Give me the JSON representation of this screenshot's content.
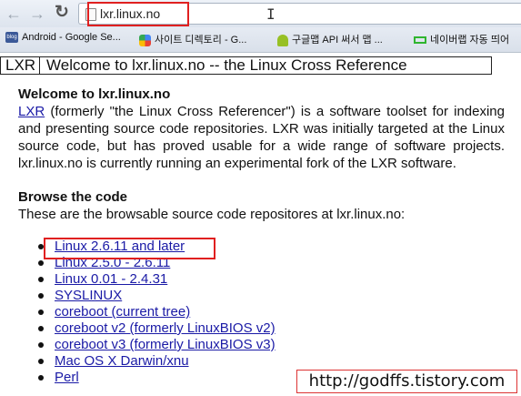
{
  "browser": {
    "back_icon": "back-arrow-icon",
    "forward_icon": "forward-arrow-icon",
    "reload_icon": "reload-icon",
    "url": "lxr.linux.no"
  },
  "bookmarks": [
    {
      "label": "Android - Google Se...",
      "icon": "blog-icon"
    },
    {
      "label": "사이트 디렉토리 - G...",
      "icon": "puzzle-icon"
    },
    {
      "label": "구글맵 API 써서 맵 ...",
      "icon": "android-icon"
    },
    {
      "label": "네이버랩 자동 띄어",
      "icon": "naver-icon"
    }
  ],
  "lxr_header": {
    "logo": "LXR",
    "title": "Welcome to lxr.linux.no -- the Linux Cross Reference"
  },
  "content": {
    "heading": "Welcome to lxr.linux.no",
    "intro_link": "LXR",
    "intro_text": " (formerly \"the Linux Cross Referencer\") is a software toolset for indexing and presenting source code repositories. LXR was initially targeted at the Linux source code, but has proved usable for a wide range of software projects. lxr.linux.no is currently running an experimental fork of the LXR software.",
    "browse_heading": "Browse the code",
    "browse_desc": "These are the browsable source code repositores at lxr.linux.no:",
    "repos": [
      "Linux 2.6.11 and later",
      "Linux 2.5.0 - 2.6.11",
      "Linux 0.01 - 2.4.31",
      "SYSLINUX",
      "coreboot (current tree)",
      "coreboot v2 (formerly LinuxBIOS v2)",
      "coreboot v3 (formerly LinuxBIOS v3)",
      "Mac OS X Darwin/xnu",
      "Perl"
    ]
  },
  "watermark": "http://godffs.tistory.com",
  "colors": {
    "highlight": "#e02020",
    "link": "#1a1aa6"
  }
}
